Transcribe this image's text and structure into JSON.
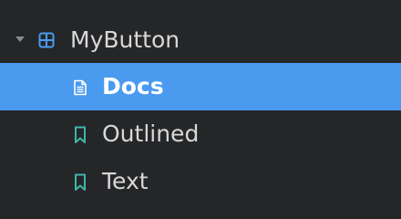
{
  "tree": {
    "parent": {
      "label": "MyButton",
      "icon": "component-icon",
      "expanded": true,
      "icon_color": "#4a9bf0"
    },
    "items": [
      {
        "label": "Docs",
        "icon": "document-icon",
        "selected": true
      },
      {
        "label": "Outlined",
        "icon": "bookmark-icon",
        "selected": false,
        "icon_color": "#3fb6a8"
      },
      {
        "label": "Text",
        "icon": "bookmark-icon",
        "selected": false,
        "icon_color": "#3fb6a8"
      }
    ]
  },
  "colors": {
    "background": "#252628",
    "selection": "#4a9bf0"
  }
}
